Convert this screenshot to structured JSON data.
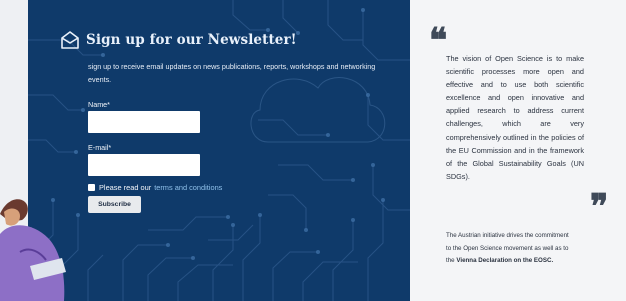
{
  "newsletter": {
    "title": "Sign up for our Newsletter!",
    "description": "sign up to receive email updates on news publications, reports, workshops and networking events.",
    "name_label": "Name*",
    "name_value": "",
    "email_label": "E-mail*",
    "email_value": "",
    "checkbox_prefix": "Please read our",
    "terms_link": "terms and conditions",
    "subscribe_label": "Subscribe",
    "icon": "mail-icon"
  },
  "quote": {
    "open_mark": "❝",
    "close_mark": "❞",
    "text": "The vision of Open Science is to make scientific processes more open and effective and to use both scientific excellence and open innovative and applied research to address current challenges, which are very comprehensively outlined in the policies of the EU Commission and in the framework of the Global Sustainability Goals (UN SDGs).",
    "initiative_text": "The Austrian initiative drives the commitment to the Open Science movement as well as to the",
    "initiative_bold": "Vienna Declaration on the EOSC."
  },
  "colors": {
    "newsletter_bg": "#0f3a6a",
    "link": "#8fc0ea",
    "page_bg": "#f4f5f7"
  }
}
